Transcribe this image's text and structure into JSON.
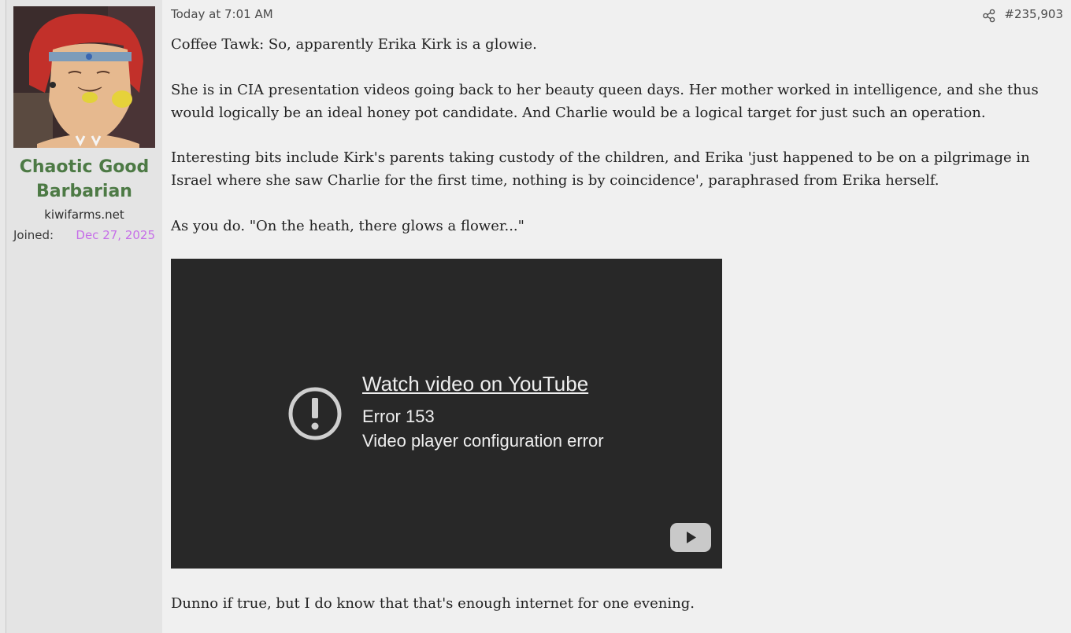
{
  "user": {
    "username_line1": "Chaotic Good",
    "username_line2": "Barbarian",
    "user_title": "kiwifarms.net",
    "joined_label": "Joined:",
    "joined_date": "Dec 27, 2025"
  },
  "post": {
    "date": "Today at 7:01 AM",
    "number": "#235,903",
    "paragraphs": [
      "Coffee Tawk: So, apparently Erika Kirk is a glowie.",
      "She is in CIA presentation videos going back to her beauty queen days. Her mother worked in intelligence, and she thus would logically be an ideal honey pot candidate. And Charlie would be a logical target for just such an operation.",
      "Interesting bits include Kirk's parents taking custody of the children, and Erika 'just happened to be on a pilgrimage in Israel where she saw Charlie for the first time, nothing is by coincidence', paraphrased from Erika herself.",
      "As you do. \"On the heath, there glows a flower...\"",
      "Dunno if true, but I do know that that's enough internet for one evening."
    ]
  },
  "video": {
    "watch_link": "Watch video on YouTube",
    "error_code": "Error 153",
    "error_message": "Video player configuration error"
  },
  "icons": {
    "share": "share-icon",
    "error": "exclamation-circle-icon",
    "youtube": "youtube-play-icon"
  },
  "colors": {
    "username": "#4d7a45",
    "joined_date": "#c66ee8",
    "video_bg": "#282828"
  }
}
